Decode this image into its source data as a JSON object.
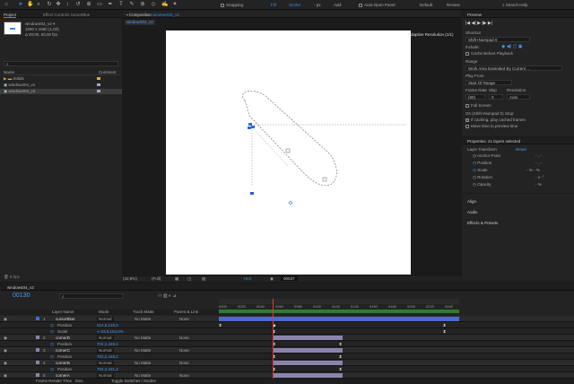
{
  "toolbar": {
    "snapping": "Snapping",
    "fill": "Fill",
    "stroke": "Stroke",
    "px": "- px",
    "add": "Add:",
    "auto_open": "Auto-Open Panel",
    "default": "Default",
    "review": "Review",
    "search": "Search Help"
  },
  "project": {
    "tab": "Project",
    "effect_tab": "Effect Controls cursorBlue",
    "comp_name": "window404_v2 ▾",
    "comp_info": [
      "1080 x 1080 (1,00)",
      "Δ 00;05, 60,00 fps"
    ],
    "col_name": "Name",
    "col_comment": "Comment",
    "items": [
      "Solids",
      "window404_v1",
      "window404_v2"
    ],
    "footer_bpc": "8 bpc"
  },
  "composition": {
    "tab_prefix": "Composition",
    "tab_name": "window404_v2",
    "subtab": "window404_v2",
    "adaptive": "Adaptive Resolution (1/1)",
    "zoom": "(42,8%)",
    "quality": "(Full)",
    "time": "00037",
    "exposure": "+0,0"
  },
  "preview": {
    "title": "Preview",
    "shortcut_label": "Shortcut",
    "shortcut_value": "Shift+Numpad 0",
    "include_label": "Include:",
    "cache": "Cache Before Playback",
    "range_label": "Range",
    "range_value": "Work Area Extended By Current ...",
    "play_from_label": "Play From",
    "play_from_value": "Start Of Range",
    "frame_rate_label": "Frame Rate",
    "skip_label": "Skip",
    "resolution_label": "Resolution",
    "frame_rate": "(60)",
    "skip": "0",
    "resolution": "Auto",
    "full_screen": "Full Screen",
    "on_stop": "On (Shift+Numpad 0) Stop:",
    "if_caching": "If caching, play cached frames",
    "move_time": "Move time to preview time"
  },
  "properties": {
    "title": "Properties: 21 layers selected",
    "layer_transform": "Layer Transform",
    "reset": "Reset",
    "rows": [
      {
        "label": "Anchor Point",
        "value": "- ,  -"
      },
      {
        "label": "Position",
        "value": "- ,  -"
      },
      {
        "label": "Scale",
        "value": "- %  - %"
      },
      {
        "label": "Rotation",
        "value": "- x  -°"
      },
      {
        "label": "Opacity",
        "value": "- %"
      }
    ],
    "align": "Align",
    "audio": "Audio",
    "effects": "Effects & Presets"
  },
  "timeline": {
    "tab": "window404_v2",
    "timecode": "00130",
    "col_layer_name": "Layer Name",
    "col_mode": "Mode",
    "col_trkmat": "Track Matte",
    "col_parent": "Parent & Link",
    "frame_render": "Frame Render Time",
    "frame_render_value": "0ms",
    "toggle": "Toggle Switches / Modes",
    "ruler": [
      "0000",
      "0020",
      "0040",
      "0060",
      "0080",
      "0100",
      "0120",
      "0140",
      "0160",
      "0180",
      "0200",
      "0220",
      "0240"
    ],
    "layers": [
      {
        "num": "1",
        "name": "cursorBlue",
        "mode": "Normal",
        "matte": "No Matte",
        "parent": "None",
        "layer": true,
        "color": "#3a6fd8"
      },
      {
        "num": "",
        "name": "Position",
        "mode": "314,5,146,8",
        "matte": "",
        "parent": "",
        "layer": false
      },
      {
        "num": "",
        "name": "Scale",
        "mode": "∞ 53,5,153,0%",
        "matte": "",
        "parent": "",
        "layer": false
      },
      {
        "num": "2",
        "name": "cornerD",
        "mode": "Normal",
        "matte": "No Matte",
        "parent": "None",
        "layer": true,
        "color": "#8b84a8"
      },
      {
        "num": "",
        "name": "Position",
        "mode": "702,2,448,2",
        "matte": "",
        "parent": "",
        "layer": false
      },
      {
        "num": "3",
        "name": "cornerC",
        "mode": "Normal",
        "matte": "No Matte",
        "parent": "None",
        "layer": true,
        "color": "#8b84a8"
      },
      {
        "num": "",
        "name": "Position",
        "mode": "702,2,448,2",
        "matte": "",
        "parent": "",
        "layer": false
      },
      {
        "num": "4",
        "name": "cornerB",
        "mode": "Normal",
        "matte": "No Matte",
        "parent": "None",
        "layer": true,
        "color": "#8b84a8"
      },
      {
        "num": "",
        "name": "Position",
        "mode": "702,2,431,2",
        "matte": "",
        "parent": "",
        "layer": false
      },
      {
        "num": "5",
        "name": "cornerA",
        "mode": "Normal",
        "matte": "No Matte",
        "parent": "None",
        "layer": true,
        "color": "#8b84a8"
      }
    ]
  }
}
